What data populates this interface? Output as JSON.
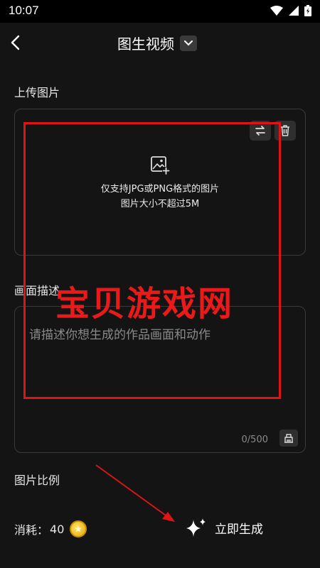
{
  "status_bar": {
    "time": "10:07"
  },
  "header": {
    "title": "图生视频"
  },
  "upload": {
    "label": "上传图片",
    "hint_line1": "仅支持JPG或PNG格式的图片",
    "hint_line2": "图片大小不超过5M"
  },
  "description": {
    "label": "画面描述",
    "placeholder": "请描述你想生成的作品画面和动作",
    "counter": "0/500"
  },
  "ratio": {
    "label": "图片比例"
  },
  "footer": {
    "cost_label": "消耗：",
    "cost_value": "40",
    "generate_label": "立即生成"
  },
  "watermark": {
    "text": "宝贝游戏网"
  },
  "colors": {
    "background": "#141414",
    "watermark_red": "#e01414",
    "coin_gold": "#f2b705"
  }
}
